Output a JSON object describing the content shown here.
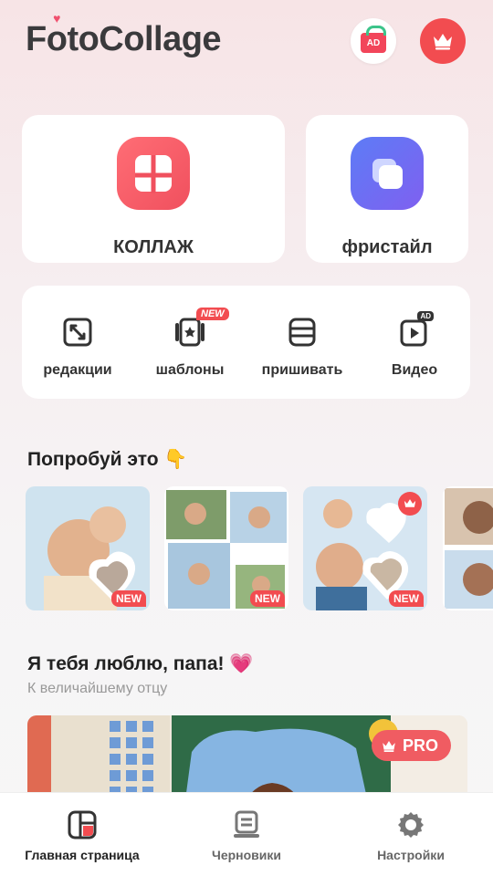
{
  "header": {
    "logo_left": "F",
    "logo_o": "o",
    "logo_rest": "toCollage",
    "ad_label": "AD"
  },
  "main_cards": {
    "collage_label": "КОЛЛАЖ",
    "freestyle_label": "фристайл"
  },
  "tools": [
    {
      "label": "редакции",
      "icon": "edit-crop-icon"
    },
    {
      "label": "шаблоны",
      "icon": "templates-icon",
      "badge": "NEW"
    },
    {
      "label": "пришивать",
      "icon": "stitch-icon"
    },
    {
      "label": "Видео",
      "icon": "video-icon",
      "badge": "AD"
    }
  ],
  "try_section": {
    "title": "Попробуй это 👇",
    "new_badge": "NEW"
  },
  "father_section": {
    "title": "Я тебя люблю, папа! 💗",
    "subtitle": "К величайшему отцу",
    "pro_badge": "PRO"
  },
  "bottom_nav": [
    {
      "label": "Главная страница",
      "icon": "home-collage-icon",
      "active": true
    },
    {
      "label": "Черновики",
      "icon": "drafts-icon",
      "active": false
    },
    {
      "label": "Настройки",
      "icon": "gear-icon",
      "active": false
    }
  ],
  "colors": {
    "accent": "#f24c50",
    "collage_icon": "#f0505e",
    "freestyle_icon": "#6a6ef3"
  }
}
